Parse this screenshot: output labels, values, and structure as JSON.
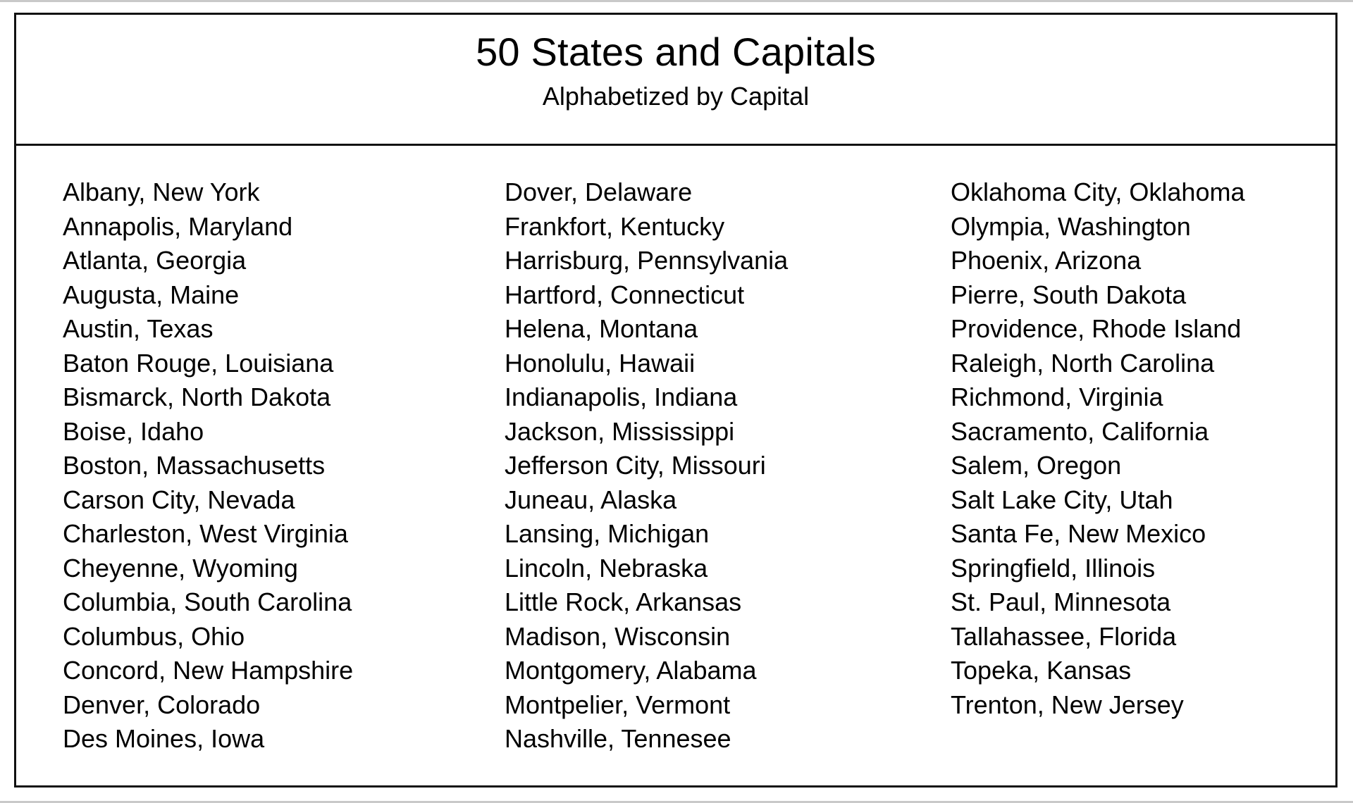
{
  "document": {
    "title": "50 States and Capitals",
    "subtitle": "Alphabetized by Capital"
  },
  "columns": [
    {
      "id": "column-1",
      "entries": [
        "Albany, New York",
        "Annapolis, Maryland",
        "Atlanta, Georgia",
        "Augusta, Maine",
        "Austin, Texas",
        "Baton Rouge, Louisiana",
        "Bismarck, North Dakota",
        "Boise, Idaho",
        "Boston, Massachusetts",
        "Carson City, Nevada",
        "Charleston, West Virginia",
        "Cheyenne, Wyoming",
        "Columbia, South Carolina",
        "Columbus, Ohio",
        "Concord, New Hampshire",
        "Denver, Colorado",
        "Des Moines, Iowa"
      ]
    },
    {
      "id": "column-2",
      "entries": [
        "Dover, Delaware",
        "Frankfort, Kentucky",
        "Harrisburg, Pennsylvania",
        "Hartford, Connecticut",
        "Helena, Montana",
        "Honolulu, Hawaii",
        "Indianapolis, Indiana",
        "Jackson, Mississippi",
        "Jefferson City, Missouri",
        "Juneau, Alaska",
        "Lansing, Michigan",
        "Lincoln, Nebraska",
        "Little Rock, Arkansas",
        "Madison, Wisconsin",
        "Montgomery, Alabama",
        "Montpelier, Vermont",
        "Nashville, Tennesee"
      ]
    },
    {
      "id": "column-3",
      "entries": [
        "Oklahoma City, Oklahoma",
        "Olympia, Washington",
        "Phoenix, Arizona",
        "Pierre, South Dakota",
        "Providence, Rhode Island",
        "Raleigh, North Carolina",
        "Richmond, Virginia",
        "Sacramento, California",
        "Salem, Oregon",
        "Salt Lake City, Utah",
        "Santa Fe, New Mexico",
        "Springfield, Illinois",
        "St. Paul, Minnesota",
        "Tallahassee, Florida",
        "Topeka, Kansas",
        "Trenton, New Jersey"
      ]
    }
  ],
  "style": {
    "text_color": "#000000",
    "background_color": "#ffffff",
    "border_color": "#111111"
  }
}
